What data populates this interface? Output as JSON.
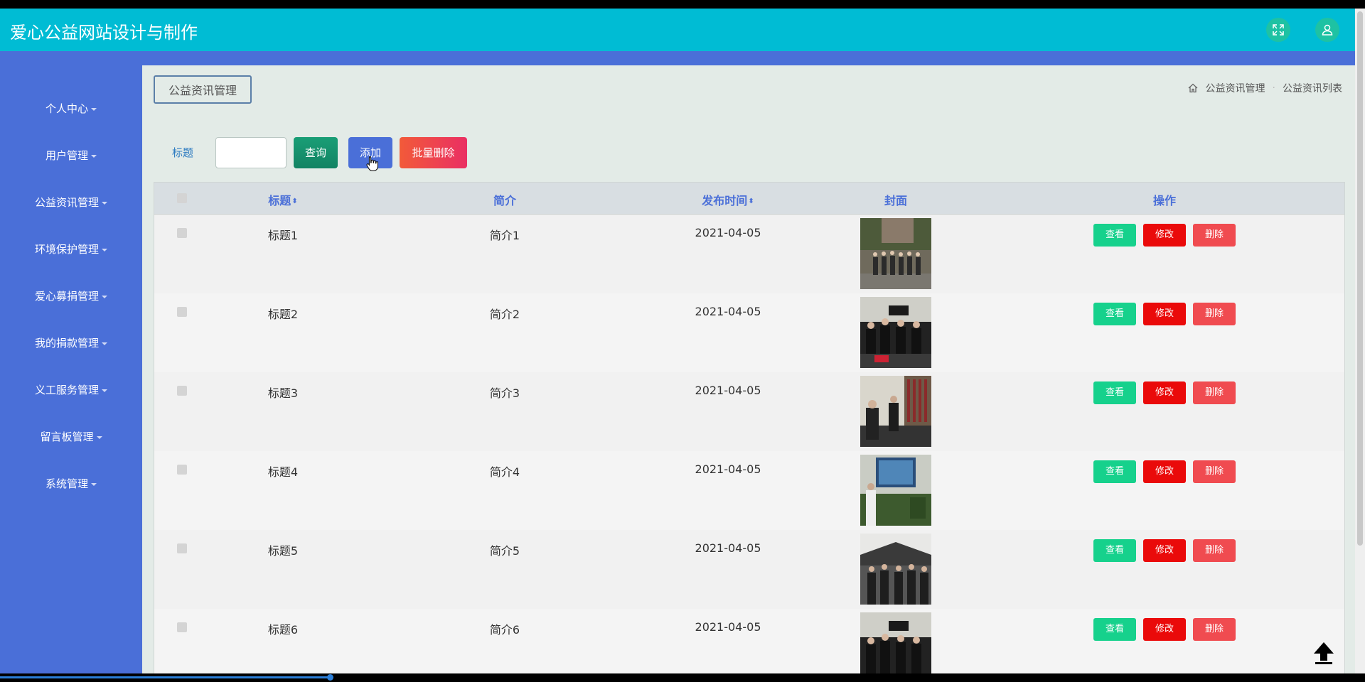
{
  "app": {
    "title": "爱心公益网站设计与制作"
  },
  "header": {
    "fullscreen_icon": "fullscreen-icon",
    "user_icon": "user-icon",
    "accent": "#00bcd4",
    "nav_color": "#4a6fd8"
  },
  "sidebar": {
    "items": [
      {
        "label": "个人中心"
      },
      {
        "label": "用户管理"
      },
      {
        "label": "公益资讯管理"
      },
      {
        "label": "环境保护管理"
      },
      {
        "label": "爱心募捐管理"
      },
      {
        "label": "我的捐款管理"
      },
      {
        "label": "义工服务管理"
      },
      {
        "label": "留言板管理"
      },
      {
        "label": "系统管理"
      }
    ]
  },
  "page": {
    "tag": "公益资讯管理",
    "breadcrumb": [
      "公益资讯管理",
      "公益资讯列表"
    ]
  },
  "search": {
    "label": "标题",
    "value": "",
    "query_label": "查询",
    "add_label": "添加",
    "bulk_delete_label": "批量删除"
  },
  "table": {
    "headers": {
      "title": "标题",
      "intro": "简介",
      "publish_time": "发布时间",
      "cover": "封面",
      "actions": "操作"
    },
    "action_labels": {
      "view": "查看",
      "edit": "修改",
      "delete": "删除"
    },
    "rows": [
      {
        "title": "标题1",
        "intro": "简介1",
        "date": "2021-04-05"
      },
      {
        "title": "标题2",
        "intro": "简介2",
        "date": "2021-04-05"
      },
      {
        "title": "标题3",
        "intro": "简介3",
        "date": "2021-04-05"
      },
      {
        "title": "标题4",
        "intro": "简介4",
        "date": "2021-04-05"
      },
      {
        "title": "标题5",
        "intro": "简介5",
        "date": "2021-04-05"
      },
      {
        "title": "标题6",
        "intro": "简介6",
        "date": "2021-04-05"
      }
    ]
  }
}
